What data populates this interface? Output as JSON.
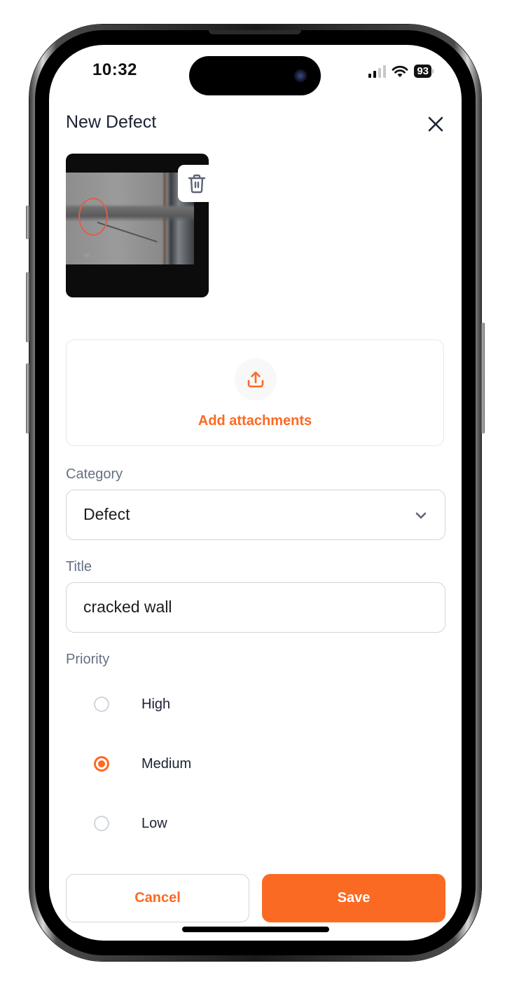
{
  "status_bar": {
    "time": "10:32",
    "battery_percent": "93",
    "signal_bars_active": 2,
    "signal_bars_total": 4,
    "wifi": "wifi-icon"
  },
  "header": {
    "title": "New Defect",
    "close_icon": "close-icon"
  },
  "photo": {
    "alt": "Cracked concrete block wall with red circle marking",
    "delete_icon": "trash-icon"
  },
  "attachments": {
    "icon": "upload-icon",
    "label": "Add attachments"
  },
  "category": {
    "label": "Category",
    "value": "Defect",
    "icon": "chevron-down-icon"
  },
  "title_field": {
    "label": "Title",
    "value": "cracked wall"
  },
  "priority": {
    "label": "Priority",
    "selected": "Medium",
    "options": [
      {
        "label": "High",
        "checked": false
      },
      {
        "label": "Medium",
        "checked": true
      },
      {
        "label": "Low",
        "checked": false
      }
    ]
  },
  "actions": {
    "cancel_label": "Cancel",
    "save_label": "Save"
  },
  "colors": {
    "accent": "#fb6a23",
    "label_gray": "#667085",
    "border": "#d0d5dd",
    "text_dark": "#1b2233"
  }
}
